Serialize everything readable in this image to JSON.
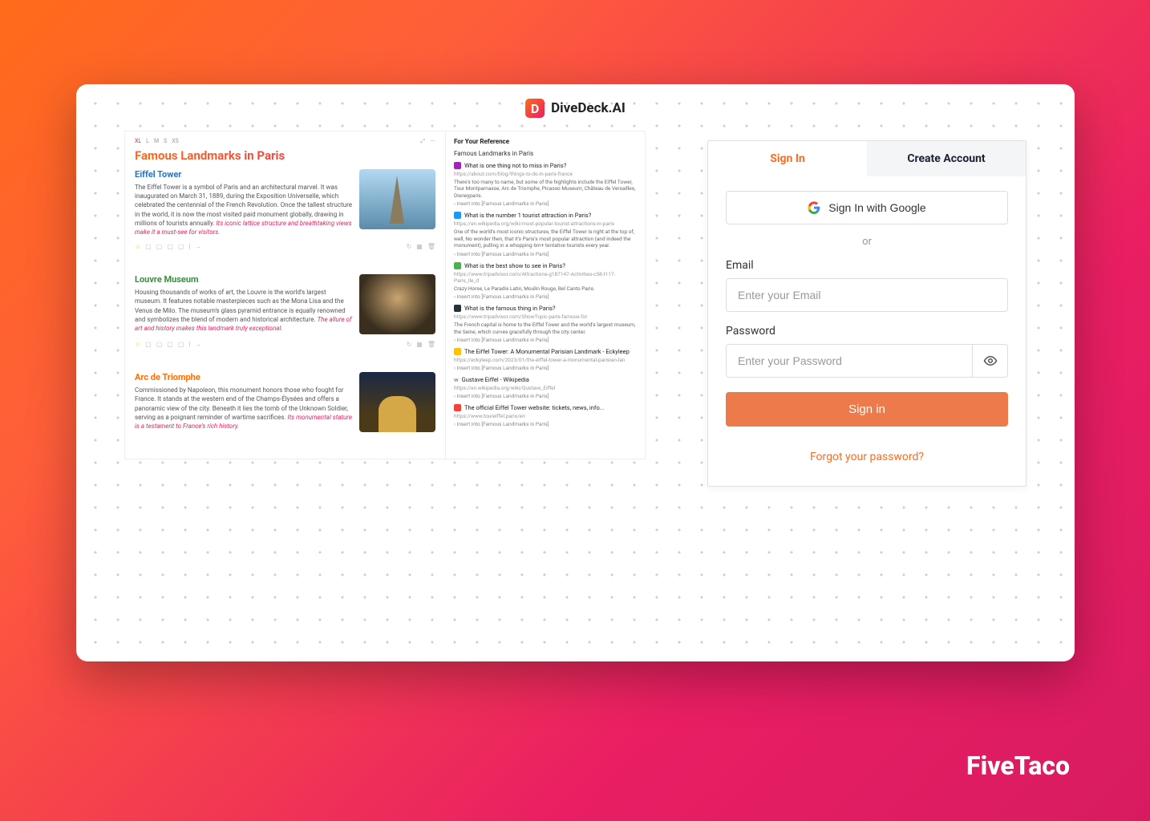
{
  "app": {
    "title": "DiveDeck.AI",
    "logo_letter": "D"
  },
  "content": {
    "size_tabs": [
      "XL",
      "L",
      "M",
      "S",
      "XS"
    ],
    "doc_title": "Famous Landmarks in Paris",
    "sections": [
      {
        "title": "Eiffel Tower",
        "body": "The Eiffel Tower is a symbol of Paris and an architectural marvel. It was inaugurated on March 31, 1889, during the Exposition Universelle, which celebrated the centennial of the French Revolution. Once the tallest structure in the world, it is now the most visited paid monument globally, drawing in millions of tourists annually.",
        "em": "Its iconic lattice structure and breathtaking views make it a must-see for visitors."
      },
      {
        "title": "Louvre Museum",
        "body": "Housing thousands of works of art, the Louvre is the world's largest museum. It features notable masterpieces such as the Mona Lisa and the Venus de Milo. The museum's glass pyramid entrance is equally renowned and symbolizes the blend of modern and historical architecture.",
        "em": "The allure of art and history makes this landmark truly exceptional."
      },
      {
        "title": "Arc de Triomphe",
        "body": "Commissioned by Napoleon, this monument honors those who fought for France. It stands at the western end of the Champs-Élysées and offers a panoramic view of the city. Beneath it lies the tomb of the Unknown Soldier, serving as a poignant reminder of wartime sacrifices.",
        "em": "Its monumental stature is a testament to France's rich history."
      }
    ]
  },
  "references": {
    "heading": "For Your Reference",
    "sub": "Famous Landmarks in Paris",
    "insert_text": "‹ Insert into [Famous Landmarks in Paris]",
    "items": [
      {
        "q": "What is one thing not to miss in Paris?",
        "url": "https://about.com/blog/things-to-do-in-paris-france",
        "desc": "There's too many to name, but some of the highlights include the Eiffel Tower, Tour Montparnasse, Arc de Triomphe, Picasso Museum, Château de Versailles, Disneyparis."
      },
      {
        "q": "What is the number 1 tourist attraction in Paris?",
        "url": "https://en.wikipedia.org/wiki/most-popular-tourist-attractions-in-paris",
        "desc": "One of the world's most iconic structures, the Eiffel Tower is right at the top of, well, No wonder then, that it's Paris's most popular attraction (and indeed the monument), pulling in a whopping 6m+ tentative tourists every year."
      },
      {
        "q": "What is the best show to see in Paris?",
        "url": "https://www.tripadvisor.com/Attractions-g187147-Activities-c58-t117-Paris_Ile_d",
        "desc": "Crazy Horse, Le Paradis Latin, Moulin Rouge, Bel Canto Paris."
      },
      {
        "q": "What is the famous thing in Paris?",
        "url": "https://www.tripadvisor.com/ShowTopic-paris-famous-for",
        "desc": "The French capital is home to the Eiffel Tower and the world's largest museum, the Seine, which curves gracefully through the city center."
      },
      {
        "q": "The Eiffel Tower: A Monumental Parisian Landmark - Eckyleep",
        "url": "https://eckyleep.com/2023/01/the-eiffel-tower-a-monumental-parisian-lan",
        "desc": ""
      },
      {
        "q": "Gustave Eiffel - Wikipedia",
        "url": "https://en.wikipedia.org/wiki/Gustave_Eiffel",
        "desc": ""
      },
      {
        "q": "The official Eiffel Tower website: tickets, news, info...",
        "url": "https://www.toureiffel.paris/en",
        "desc": ""
      }
    ]
  },
  "auth": {
    "tabs": {
      "signin": "Sign In",
      "create": "Create Account"
    },
    "google": "Sign In with Google",
    "divider": "or",
    "email_label": "Email",
    "email_placeholder": "Enter your Email",
    "password_label": "Password",
    "password_placeholder": "Enter your Password",
    "signin_btn": "Sign in",
    "forgot": "Forgot your password?"
  },
  "brand": "FiveTaco"
}
